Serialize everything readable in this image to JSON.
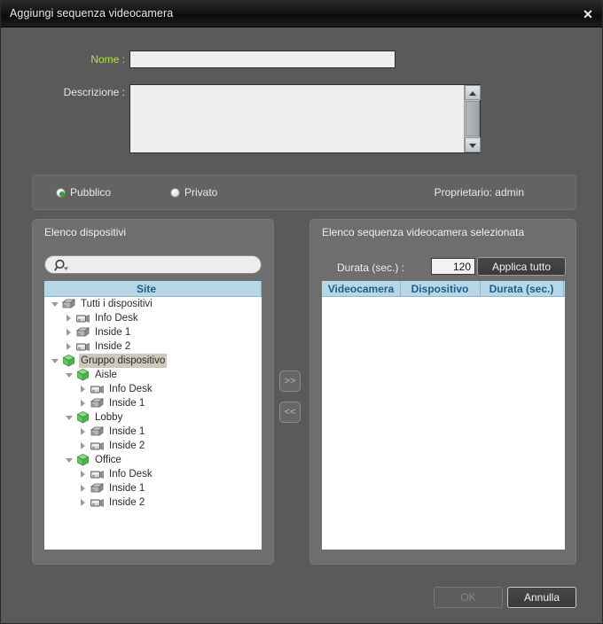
{
  "window": {
    "title": "Aggiungi sequenza videocamera",
    "close_icon": "close-icon",
    "close_label": "✕"
  },
  "form": {
    "name_label": "Nome :",
    "name_value": "",
    "name_placeholder": "",
    "description_label": "Descrizione :",
    "description_value": "",
    "description_placeholder": ""
  },
  "visibility": {
    "public_label": "Pubblico",
    "private_label": "Privato",
    "selected": "Pubblico",
    "owner_text": "Proprietario: admin"
  },
  "device_panel": {
    "title": "Elenco dispositivi",
    "search_value": "",
    "search_placeholder": "",
    "search_icon": "search-icon",
    "column_header": "Site",
    "tree": [
      {
        "label": "Tutti i dispositivi",
        "indent": 0,
        "expander": "down",
        "icon": "device-box-icon",
        "selected": false
      },
      {
        "label": "Info Desk",
        "indent": 1,
        "expander": "right",
        "icon": "camera-icon",
        "selected": false
      },
      {
        "label": "Inside 1",
        "indent": 1,
        "expander": "right",
        "icon": "device-box-icon",
        "selected": false
      },
      {
        "label": "Inside 2",
        "indent": 1,
        "expander": "right",
        "icon": "camera-icon",
        "selected": false
      },
      {
        "label": "Gruppo dispositivo",
        "indent": 0,
        "expander": "down",
        "icon": "group-cube-icon",
        "selected": true
      },
      {
        "label": "Aisle",
        "indent": 1,
        "expander": "down",
        "icon": "group-cube-icon",
        "selected": false
      },
      {
        "label": "Info Desk",
        "indent": 2,
        "expander": "right",
        "icon": "camera-icon",
        "selected": false
      },
      {
        "label": "Inside 1",
        "indent": 2,
        "expander": "right",
        "icon": "device-box-icon",
        "selected": false
      },
      {
        "label": "Lobby",
        "indent": 1,
        "expander": "down",
        "icon": "group-cube-icon",
        "selected": false
      },
      {
        "label": "Inside 1",
        "indent": 2,
        "expander": "right",
        "icon": "device-box-icon",
        "selected": false
      },
      {
        "label": "Inside 2",
        "indent": 2,
        "expander": "right",
        "icon": "camera-icon",
        "selected": false
      },
      {
        "label": "Office",
        "indent": 1,
        "expander": "down",
        "icon": "group-cube-icon",
        "selected": false
      },
      {
        "label": "Info Desk",
        "indent": 2,
        "expander": "right",
        "icon": "camera-icon",
        "selected": false
      },
      {
        "label": "Inside 1",
        "indent": 2,
        "expander": "right",
        "icon": "device-box-icon",
        "selected": false
      },
      {
        "label": "Inside 2",
        "indent": 2,
        "expander": "right",
        "icon": "camera-icon",
        "selected": false
      }
    ]
  },
  "sequence_panel": {
    "title": "Elenco sequenza videocamera selezionata",
    "duration_label": "Durata (sec.) :",
    "duration_value": "120",
    "apply_all_label": "Applica tutto",
    "columns": [
      "Videocamera",
      "Dispositivo",
      "Durata (sec.)"
    ],
    "rows": []
  },
  "transfer": {
    "add_label": ">>",
    "remove_label": "<<"
  },
  "footer": {
    "ok_label": "OK",
    "ok_enabled": false,
    "cancel_label": "Annulla"
  },
  "colors": {
    "dialog_bg": "#5a5a5a",
    "panel_bg": "#6e6e6e",
    "header_blue_bg": "#b5d7e8",
    "header_blue_text": "#1f5e86",
    "accent_green": "#b3e048",
    "radio_green": "#31a531"
  }
}
